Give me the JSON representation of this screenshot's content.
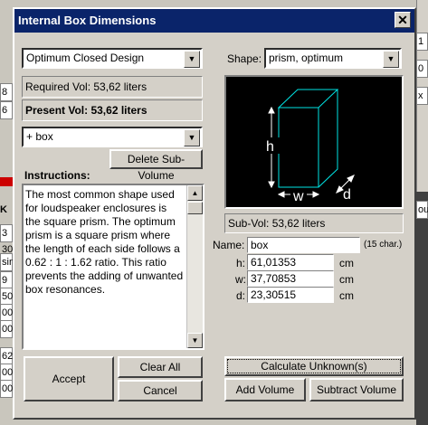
{
  "window": {
    "title": "Internal Box Dimensions",
    "close_glyph": "✕"
  },
  "background_app": {
    "left_cells": [
      "8",
      "6",
      "",
      "K",
      "3 30",
      "sin",
      "9",
      "50",
      "00",
      "00",
      "62",
      "00",
      "00"
    ],
    "right_cells": [
      "1",
      "0",
      "x",
      "ous"
    ]
  },
  "design_select": {
    "value": "Optimum Closed Design"
  },
  "required_vol": {
    "text": "Required Vol: 53,62 liters"
  },
  "present_vol": {
    "text": "Present Vol: 53,62 liters"
  },
  "subvolume_select": {
    "value": "+  box"
  },
  "delete_subvolume_button": {
    "label": "Delete Sub-Volume"
  },
  "instructions": {
    "heading": "Instructions:",
    "text": "The most common shape used for loudspeaker enclosures is the square prism. The optimum prism is a square prism where the length of each side follows a 0.62 : 1 : 1.62 ratio. This ratio prevents the adding of unwanted box resonances."
  },
  "shape": {
    "label": "Shape:",
    "value": "prism, optimum"
  },
  "diagram": {
    "h": "h",
    "w": "w",
    "d": "d",
    "accent": "#00e5e5",
    "dim_color": "#ffffff"
  },
  "subvol": {
    "text": "Sub-Vol: 53,62 liters"
  },
  "name_field": {
    "label": "Name:",
    "value": "box",
    "hint": "(15 char.)"
  },
  "dims": [
    {
      "label": "h:",
      "value": "61,01353",
      "unit": "cm"
    },
    {
      "label": "w:",
      "value": "37,70853",
      "unit": "cm"
    },
    {
      "label": "d:",
      "value": "23,30515",
      "unit": "cm"
    }
  ],
  "buttons": {
    "accept": "Accept",
    "clear_all": "Clear All",
    "cancel": "Cancel",
    "calculate_unknowns": "Calculate Unknown(s)",
    "add_volume": "Add Volume",
    "subtract_volume": "Subtract Volume"
  }
}
